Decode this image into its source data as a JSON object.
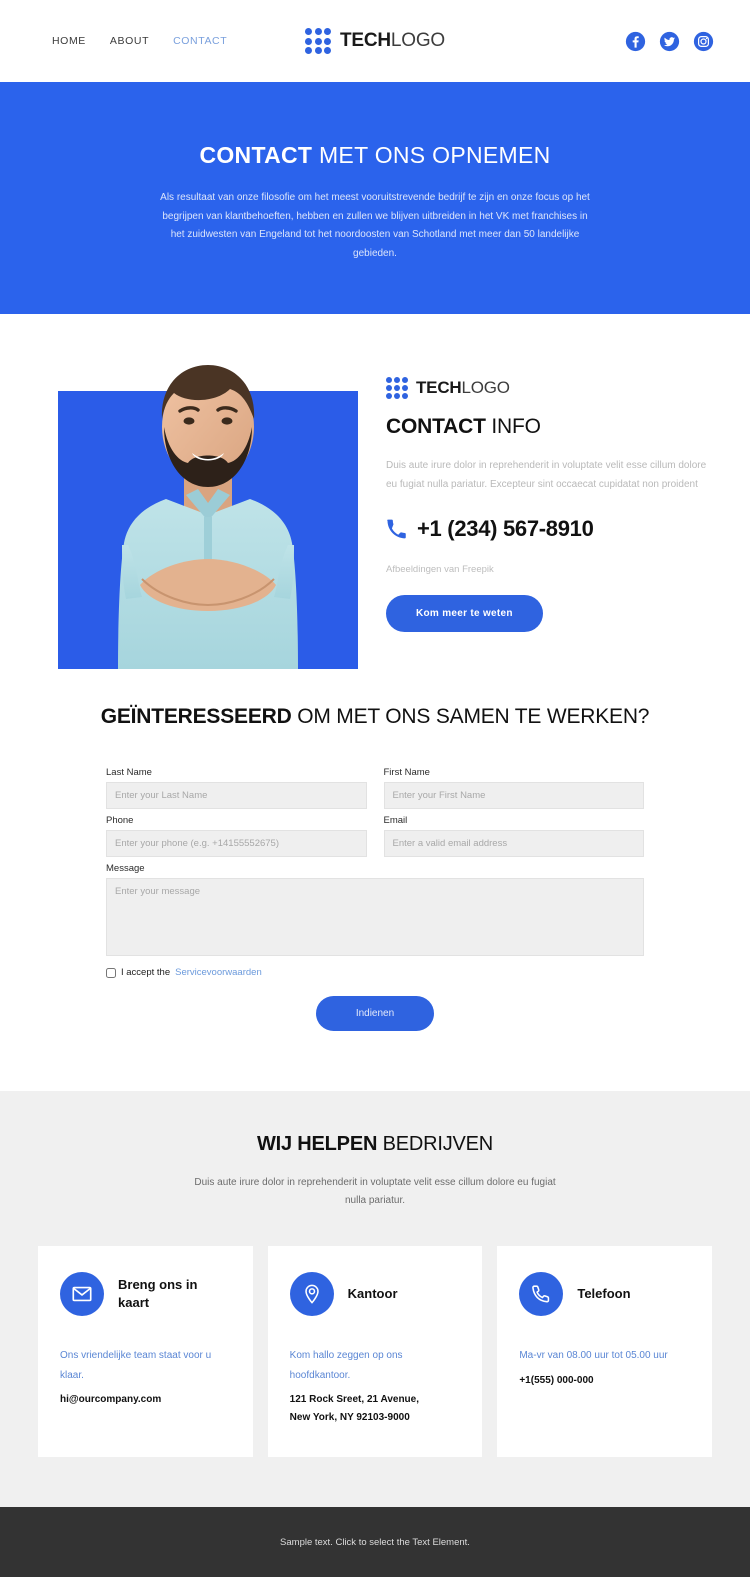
{
  "colors": {
    "brand_blue": "#2B63EC",
    "button_blue": "#2F63E0",
    "link_blue": "#5A86D4",
    "gray_section": "#F0F0F0",
    "footer_dark": "#333333"
  },
  "header": {
    "nav": [
      {
        "label": "HOME",
        "active": false
      },
      {
        "label": "ABOUT",
        "active": false
      },
      {
        "label": "CONTACT",
        "active": true
      }
    ],
    "logo": {
      "bold": "TECH",
      "light": "LOGO"
    },
    "socials": [
      {
        "name": "facebook-icon"
      },
      {
        "name": "twitter-icon"
      },
      {
        "name": "instagram-icon"
      }
    ]
  },
  "hero": {
    "title_bold": "CONTACT",
    "title_rest": " MET ONS OPNEMEN",
    "paragraph": "Als resultaat van onze filosofie om het meest vooruitstrevende bedrijf te zijn en onze focus op het begrijpen van klantbehoeften, hebben en zullen we blijven uitbreiden in het VK met franchises in het zuidwesten van Engeland tot het noordoosten van Schotland met meer dan 50 landelijke gebieden."
  },
  "info": {
    "logo": {
      "bold": "TECH",
      "light": "LOGO"
    },
    "title_bold": "CONTACT",
    "title_rest": " INFO",
    "description": "Duis aute irure dolor in reprehenderit in voluptate velit esse cillum dolore eu fugiat nulla pariatur. Excepteur sint occaecat cupidatat non proident",
    "phone": "+1 (234) 567-8910",
    "credit_text": "Afbeeldingen van ",
    "credit_source": "Freepik",
    "cta_label": "Kom meer te weten"
  },
  "form": {
    "title_bold": "GEÏNTERESSEERD",
    "title_rest": " OM MET ONS SAMEN TE WERKEN?",
    "fields": [
      {
        "label": "Last Name",
        "placeholder": "Enter your Last Name"
      },
      {
        "label": "First Name",
        "placeholder": "Enter your First Name"
      },
      {
        "label": "Phone",
        "placeholder": "Enter your phone (e.g. +14155552675)"
      },
      {
        "label": "Email",
        "placeholder": "Enter a valid email address"
      },
      {
        "label": "Message",
        "placeholder": "Enter your message"
      }
    ],
    "accept_text": "I accept the ",
    "accept_link": "Servicevoorwaarden",
    "submit_label": "Indienen"
  },
  "help": {
    "title_bold": "WIJ HELPEN",
    "title_rest": " BEDRIJVEN",
    "subtitle": "Duis aute irure dolor in reprehenderit in voluptate velit esse cillum dolore eu fugiat nulla pariatur.",
    "cards": [
      {
        "icon": "envelope-icon",
        "title": "Breng ons in kaart",
        "link": "Ons vriendelijke team staat voor u klaar.",
        "value": "hi@ourcompany.com"
      },
      {
        "icon": "map-pin-icon",
        "title": "Kantoor",
        "link": "Kom hallo zeggen op ons hoofdkantoor.",
        "value": "121 Rock Sreet, 21 Avenue,",
        "value2": "New York, NY 92103-9000"
      },
      {
        "icon": "phone-icon",
        "title": "Telefoon",
        "link": "Ma-vr van 08.00 uur tot 05.00 uur",
        "value": "+1(555) 000-000"
      }
    ]
  },
  "footer": {
    "text": "Sample text. Click to select the Text Element."
  }
}
